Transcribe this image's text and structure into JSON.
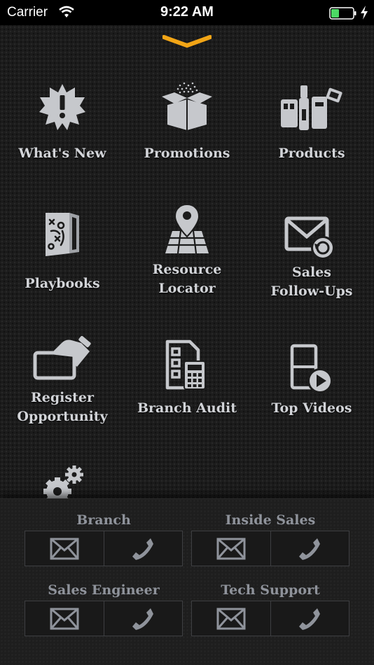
{
  "status_bar": {
    "carrier": "Carrier",
    "time": "9:22 AM"
  },
  "colors": {
    "accent": "#f2a516",
    "icon": "#c6c8cc",
    "label": "#d2d4d8",
    "contact_label": "#8f939b",
    "battery": "#4cd964"
  },
  "menu": {
    "items": [
      {
        "label": "What's New",
        "icon": "alert-burst-icon"
      },
      {
        "label": "Promotions",
        "icon": "open-box-icon"
      },
      {
        "label": "Products",
        "icon": "products-icon"
      },
      {
        "label": "Playbooks",
        "icon": "playbook-icon"
      },
      {
        "label": "Resource\nLocator",
        "icon": "map-pin-icon"
      },
      {
        "label": "Sales\nFollow-Ups",
        "icon": "mail-followup-icon"
      },
      {
        "label": "Register\nOpportunity",
        "icon": "card-hand-icon"
      },
      {
        "label": "Branch Audit",
        "icon": "checklist-calculator-icon"
      },
      {
        "label": "Top Videos",
        "icon": "video-play-icon"
      },
      {
        "label": "",
        "icon": "gears-icon"
      }
    ]
  },
  "contacts": [
    {
      "label": "Branch",
      "actions": [
        "email-icon",
        "phone-icon"
      ]
    },
    {
      "label": "Inside Sales",
      "actions": [
        "email-icon",
        "phone-icon"
      ]
    },
    {
      "label": "Sales Engineer",
      "actions": [
        "email-icon",
        "phone-icon"
      ]
    },
    {
      "label": "Tech Support",
      "actions": [
        "email-icon",
        "phone-icon"
      ]
    }
  ]
}
